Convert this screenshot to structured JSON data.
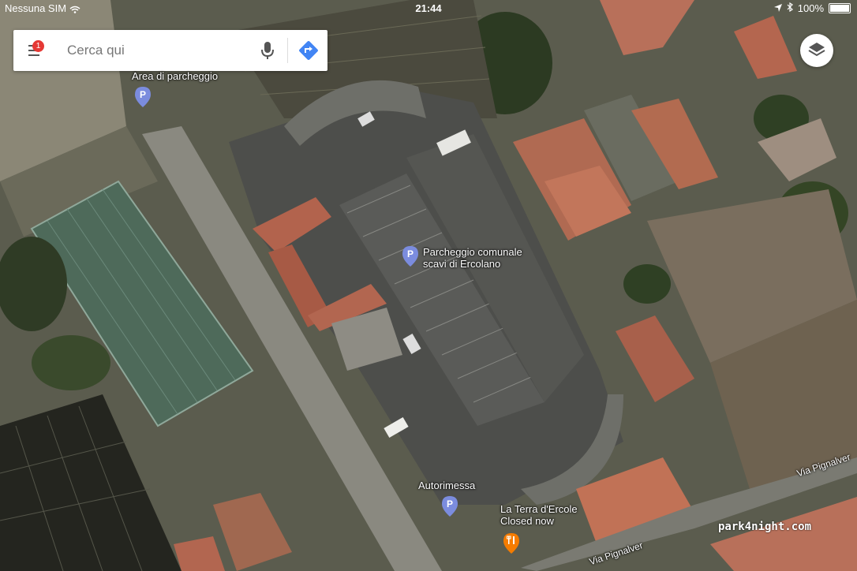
{
  "status_bar": {
    "carrier": "Nessuna SIM",
    "time": "21:44",
    "battery": "100%"
  },
  "search": {
    "placeholder": "Cerca qui",
    "notification_count": "1",
    "icons": [
      "menu-icon",
      "microphone-icon",
      "directions-icon"
    ]
  },
  "layers_button": {
    "icon": "layers-icon"
  },
  "places": [
    {
      "name": "Area di parcheggio",
      "type": "parking"
    },
    {
      "name": "Parcheggio comunale",
      "name_line2": "scavi di Ercolano",
      "type": "parking"
    },
    {
      "name": "Autorimessa",
      "type": "parking"
    },
    {
      "name": "La Terra d'Ercole",
      "name_line2": "Closed now",
      "type": "restaurant"
    }
  ],
  "roads": [
    "Via Pignalver",
    "Via Pignalver"
  ],
  "watermark": "park4night.com",
  "colors": {
    "parking_pin": "#7b8cde",
    "restaurant_pin": "#f57c00",
    "notification": "#e53935",
    "directions": "#4285f4"
  }
}
